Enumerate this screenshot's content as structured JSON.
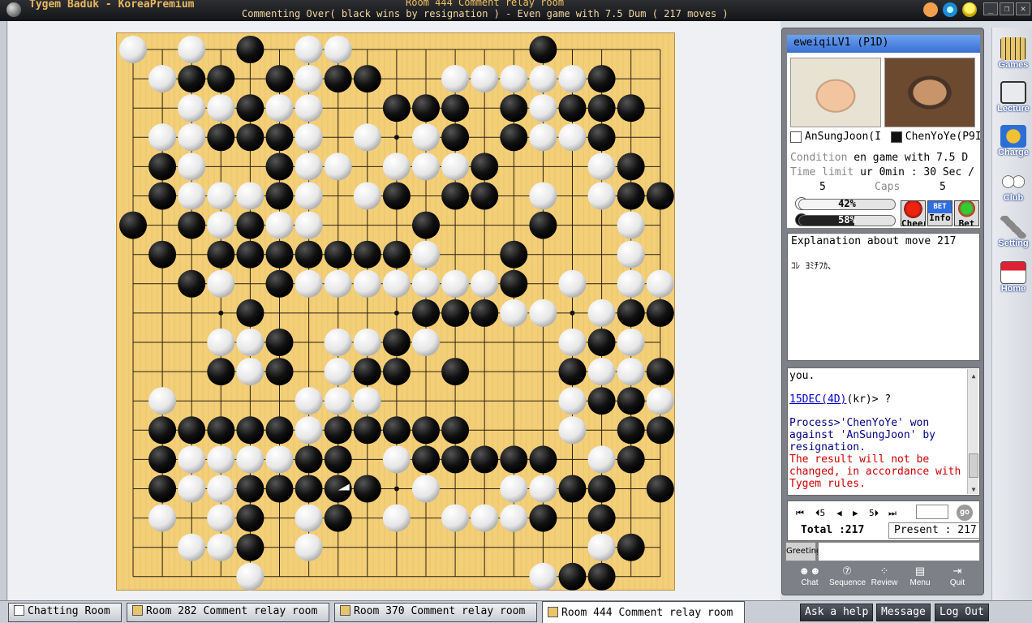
{
  "window": {
    "app_title": "Tygem Baduk - KoreaPremium",
    "room_title": "Room 444 Comment relay room",
    "game_status": "Commenting Over( black wins by resignation ) - Even game with 7.5 Dum  ( 217 moves )",
    "controls": [
      "_",
      "❐",
      "✕"
    ]
  },
  "board": {
    "size": 19,
    "star_points": [
      [
        3,
        3
      ],
      [
        9,
        3
      ],
      [
        15,
        3
      ],
      [
        3,
        9
      ],
      [
        9,
        9
      ],
      [
        15,
        9
      ],
      [
        3,
        15
      ],
      [
        9,
        15
      ],
      [
        15,
        15
      ]
    ],
    "last_move": [
      7,
      15
    ],
    "rows": [
      "W.W.B.WW......B....",
      ".WBB.BWBB..WWWWWB..",
      "..WWBWW..BBB.BWBBB.",
      ".WWBBBW.W.WB.BWWB..",
      ".BW..BWW.WWWB...WB.",
      ".BWWWBW.WB.BB.W.WBB",
      "B.BWBWW...B...B..W.",
      ".B.BBBBBBBW..B...W.",
      "..BW.BWWWWWWWB.W.WW",
      "....B.....BBBWW.WBBB",
      "...WWB.WWBW....WBW.B.",
      "...BWB.WBB.B...BWWB.",
      ".W....WWW......WBBWB.",
      ".BBBBBWBBBBB...W.BB.B.",
      ".BWWWWBB.WBBBBB.WB..",
      ".BWWBBBBB.W..WWBB.B.",
      ".W.WB.WB.W.WWWB.B...",
      "..WWB.W.........WB....",
      "....W.........WBB...."
    ]
  },
  "panel": {
    "header": "eweiqiLV1 (P1D)",
    "white_name": "AnSungJoon(I",
    "black_name": "ChenYoYe(P9I",
    "condition_key": "Condition",
    "condition_val": "en game with 7.5 D",
    "timelimit_key": "Time limit",
    "timelimit_val": "ur 0min : 30 Sec /",
    "caps_white": "5",
    "caps_label": "Caps",
    "caps_black": "5",
    "white_pct": "42%",
    "black_pct": "58%",
    "white_frac": 0.42,
    "black_frac": 0.58,
    "cheer": "Cheer",
    "info": "Info",
    "bet": "Bet",
    "bet_badge": "BET"
  },
  "explain": {
    "title": "Explanation about move 217",
    "body": "ｺﾚ ﾖﾐﾁﾌｶ､"
  },
  "chat": {
    "line1": "you.",
    "user": "15DEC(4D)",
    "user_rest": "(kr)> ?",
    "process": "Process>'ChenYoYe' won against 'AnSungJoon' by resignation.",
    "notice": "The result will not be changed, in accordance with Tygem rules."
  },
  "nav": {
    "first": "⏮",
    "back5": "⏴5",
    "prev": "◀",
    "next": "▶",
    "fwd5": "5⏵",
    "last": "⏭",
    "go": "go",
    "total": "Total :217",
    "present": "Present : 217"
  },
  "greeting": "Greeting",
  "bottom_buttons": [
    "Chat",
    "Sequence",
    "Review",
    "Menu",
    "Quit"
  ],
  "side_nav": [
    "Games",
    "Lecture",
    "Charge",
    "Club",
    "Setting",
    "Home"
  ],
  "tabs": [
    "Chatting Room",
    "Room 282 Comment relay room",
    "Room 370 Comment relay room",
    "Room 444 Comment relay room"
  ],
  "actions": [
    "Ask a help",
    "Message",
    "Log Out"
  ],
  "colors": {
    "board": "#f3cf78",
    "chat_user": "#0000cc",
    "chat_process": "#000080",
    "chat_notice": "#cc0000",
    "white_bar": "#f4f4f4",
    "black_bar": "#222222"
  }
}
